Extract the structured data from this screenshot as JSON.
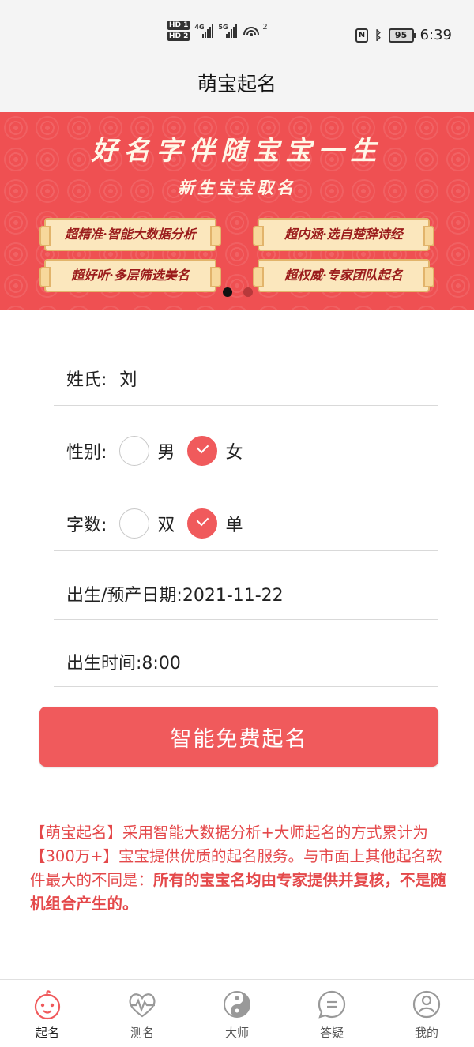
{
  "status": {
    "sim1": "HD 1",
    "sim2": "HD 2",
    "net1": "4G",
    "net2": "5G",
    "hotspot_count": "2",
    "nfc": "N",
    "battery": "95",
    "time": "6:39"
  },
  "header": {
    "title": "萌宝起名"
  },
  "banner": {
    "title": "好名字伴随宝宝一生",
    "subtitle": "新生宝宝取名",
    "tags": [
      "超精准·智能大数据分析",
      "超内涵·选自楚辞诗经",
      "超好听·多层筛选美名",
      "超权威·专家团队起名"
    ],
    "active_slide": 1,
    "slide_count": 2
  },
  "form": {
    "surname_label": "姓氏:",
    "surname_value": "刘",
    "gender_label": "性别:",
    "gender_options": [
      "男",
      "女"
    ],
    "gender_selected": "女",
    "count_label": "字数:",
    "count_options": [
      "双",
      "单"
    ],
    "count_selected": "单",
    "date_text": "出生/预产日期:2021-11-22",
    "time_text": "出生时间:8:00",
    "submit_label": "智能免费起名"
  },
  "description": {
    "part1": "【萌宝起名】采用智能大数据分析+大师起名的方式累计为【300万+】宝宝提供优质的起名服务。与市面上其他起名软件最大的不同是：",
    "part2": "所有的宝宝名均由专家提供并复核，不是随机组合产生的。"
  },
  "tabbar": {
    "items": [
      {
        "label": "起名",
        "icon": "baby-face-icon",
        "active": true
      },
      {
        "label": "测名",
        "icon": "heart-pulse-icon",
        "active": false
      },
      {
        "label": "大师",
        "icon": "yin-yang-icon",
        "active": false
      },
      {
        "label": "答疑",
        "icon": "chat-bubble-icon",
        "active": false
      },
      {
        "label": "我的",
        "icon": "user-icon",
        "active": false
      }
    ]
  },
  "colors": {
    "accent": "#f05a5c",
    "banner_red": "#ef5052",
    "tag_bg": "#fbe7bd",
    "text_red": "#e4484a"
  }
}
